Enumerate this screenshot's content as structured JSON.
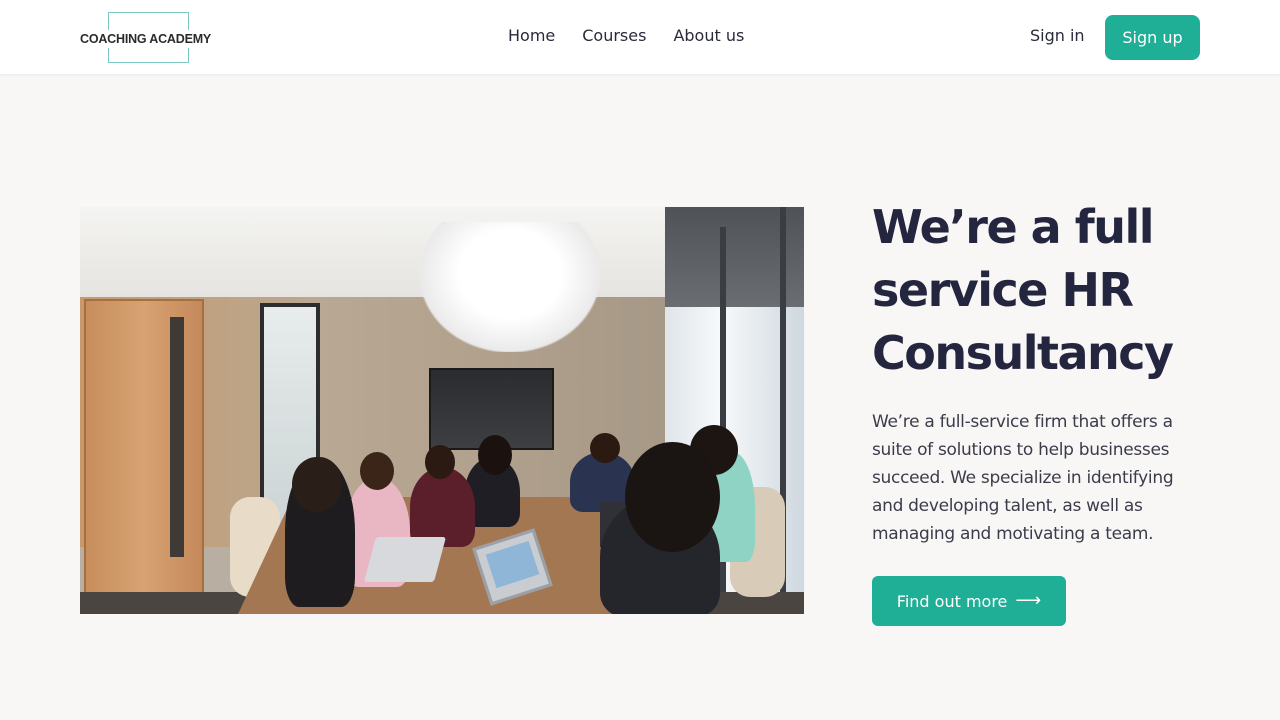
{
  "header": {
    "logo_text": "COACHING ACADEMY",
    "nav": [
      {
        "label": "Home"
      },
      {
        "label": "Courses"
      },
      {
        "label": "About us"
      }
    ],
    "sign_in": "Sign in",
    "sign_up": "Sign up"
  },
  "hero": {
    "image_alt": "Team meeting in an office conference room",
    "title": "We’re a full\nservice HR\nConsultancy",
    "description": "We’re a full-service firm that offers a suite of solutions to help businesses succeed. We specialize in identifying and developing talent, as well as managing and motivating a team.",
    "cta_label": "Find out more",
    "cta_icon": "arrow-right-icon"
  },
  "colors": {
    "accent": "#1fae96",
    "heading": "#24253f",
    "background": "#f8f7f6",
    "logo_frame": "#7cc6c3"
  }
}
